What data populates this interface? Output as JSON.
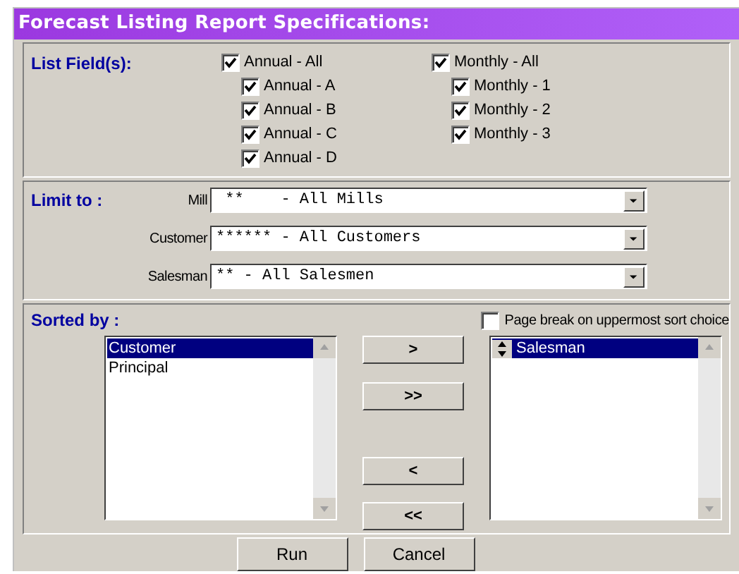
{
  "title": "Forecast Listing Report Specifications:",
  "list_fields": {
    "label": "List Field(s):",
    "groups": [
      {
        "label": "Annual - All",
        "checked": true,
        "children": [
          {
            "label": "Annual - A",
            "checked": true
          },
          {
            "label": "Annual - B",
            "checked": true
          },
          {
            "label": "Annual - C",
            "checked": true
          },
          {
            "label": "Annual - D",
            "checked": true
          }
        ]
      },
      {
        "label": "Monthly - All",
        "checked": true,
        "children": [
          {
            "label": "Monthly - 1",
            "checked": true
          },
          {
            "label": "Monthly - 2",
            "checked": true
          },
          {
            "label": "Monthly - 3",
            "checked": true
          }
        ]
      }
    ]
  },
  "limit_to": {
    "label": "Limit to :",
    "fields": [
      {
        "label": "Mill",
        "value": " **    - All Mills"
      },
      {
        "label": "Customer",
        "value": "****** - All Customers"
      },
      {
        "label": "Salesman",
        "value": "** - All Salesmen"
      }
    ]
  },
  "sorted_by": {
    "label": "Sorted by :",
    "page_break": {
      "label": "Page break on uppermost sort choice",
      "checked": false
    },
    "available": [
      {
        "label": "Customer",
        "selected": true
      },
      {
        "label": "Principal",
        "selected": false
      }
    ],
    "chosen": [
      {
        "label": "Salesman",
        "selected": true
      }
    ],
    "move_buttons": [
      ">",
      ">>",
      "<",
      "<<"
    ]
  },
  "buttons": [
    "Run",
    "Cancel"
  ]
}
